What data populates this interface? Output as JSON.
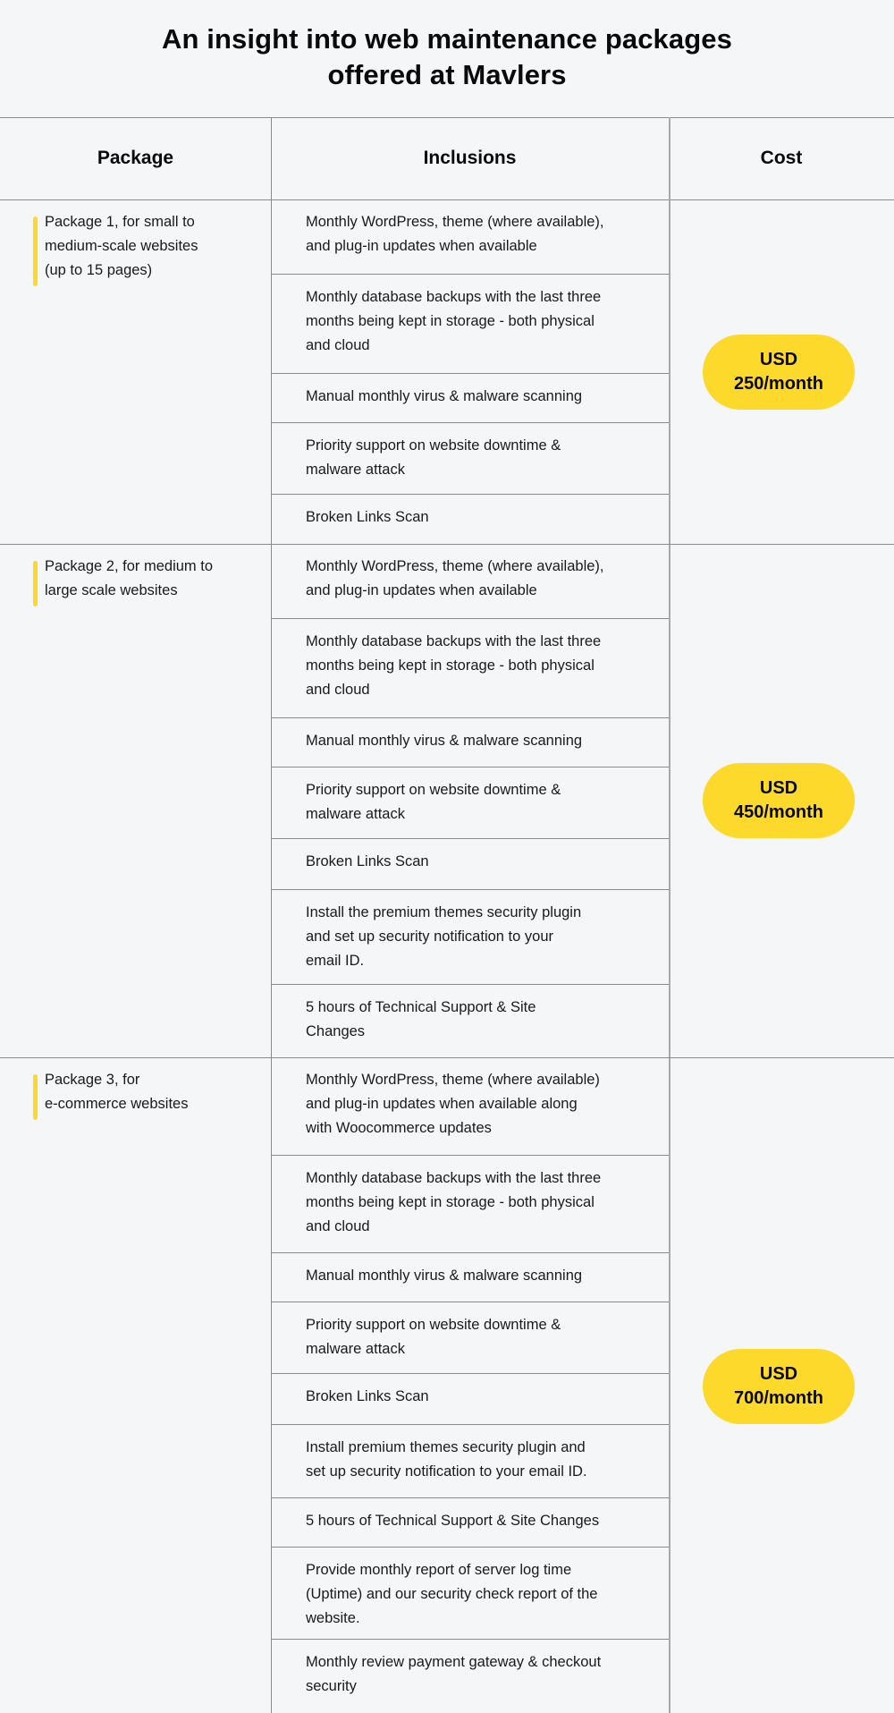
{
  "title": {
    "line1": "An insight into web maintenance packages",
    "line2": "offered at Mavlers"
  },
  "columns": {
    "package": "Package",
    "inclusions": "Inclusions",
    "cost": "Cost"
  },
  "accent_color": "#fdd92b",
  "packages": [
    {
      "label_lines": [
        "Package 1, for small to",
        "medium-scale websites",
        "(up to 15 pages)"
      ],
      "cost_line1": "USD",
      "cost_line2": "250/month",
      "inclusions": [
        [
          "Monthly WordPress, theme (where available),",
          "and plug-in updates when available"
        ],
        [
          "Monthly database backups with the last three",
          "months being kept in storage - both physical",
          "and cloud"
        ],
        [
          "Manual monthly virus & malware scanning"
        ],
        [
          "Priority support on website downtime &",
          "malware attack"
        ],
        [
          "Broken Links Scan"
        ]
      ]
    },
    {
      "label_lines": [
        "Package 2, for medium to",
        "large scale websites"
      ],
      "cost_line1": "USD",
      "cost_line2": "450/month",
      "inclusions": [
        [
          "Monthly WordPress, theme (where available),",
          "and plug-in updates when available"
        ],
        [
          "Monthly database backups with the last three",
          "months being kept in storage - both physical",
          "and cloud"
        ],
        [
          "Manual monthly virus & malware scanning"
        ],
        [
          "Priority support on website downtime &",
          "malware attack"
        ],
        [
          "Broken Links Scan"
        ],
        [
          "Install the premium themes security plugin",
          "and set up security notification to your",
          "email ID."
        ],
        [
          "5 hours of Technical Support & Site",
          "Changes"
        ]
      ]
    },
    {
      "label_lines": [
        "Package 3, for",
        "e-commerce websites"
      ],
      "cost_line1": "USD",
      "cost_line2": "700/month",
      "inclusions": [
        [
          "Monthly WordPress, theme (where available)",
          "and plug-in updates when available along",
          "with Woocommerce updates"
        ],
        [
          "Monthly database backups with the last three",
          "months being kept in storage - both physical",
          "and cloud"
        ],
        [
          "Manual monthly virus & malware scanning"
        ],
        [
          "Priority support on website downtime &",
          "malware attack"
        ],
        [
          "Broken Links Scan"
        ],
        [
          "Install premium themes security plugin and",
          "set up security notification to your email ID."
        ],
        [
          "5 hours of Technical Support & Site Changes"
        ],
        [
          "Provide monthly report of server log time",
          "(Uptime) and our security check report of the",
          "website."
        ],
        [
          "Monthly review payment gateway & checkout",
          "security"
        ]
      ]
    }
  ]
}
